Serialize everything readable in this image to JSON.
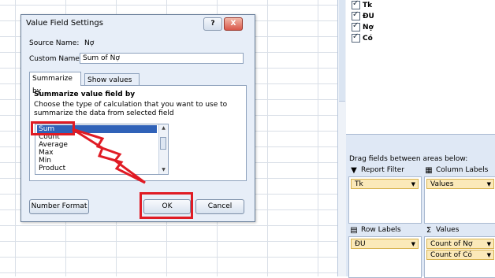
{
  "dialog": {
    "title": "Value Field Settings",
    "help_label": "?",
    "close_label": "X",
    "source_name_label": "Source Name:",
    "source_name_value": "Nợ",
    "custom_name_label": "Custom Name:",
    "custom_name_value": "Sum of Nợ",
    "tabs": [
      {
        "label": "Summarize by"
      },
      {
        "label": "Show values as"
      }
    ],
    "section_title": "Summarize value field by",
    "description": "Choose the type of calculation that you want to use to summarize the data from selected field",
    "functions": [
      "Sum",
      "Count",
      "Average",
      "Max",
      "Min",
      "Product"
    ],
    "selected_function": "Sum",
    "number_format_label": "Number Format",
    "ok_label": "OK",
    "cancel_label": "Cancel"
  },
  "field_list": {
    "fields": [
      {
        "label": "Tk"
      },
      {
        "label": "ĐU"
      },
      {
        "label": "Nợ"
      },
      {
        "label": "Có"
      }
    ],
    "drag_hint": "Drag fields between areas below:",
    "report_filter": {
      "label": "Report Filter",
      "items": [
        "Tk"
      ]
    },
    "column_labels": {
      "label": "Column Labels",
      "items": [
        "Values"
      ]
    },
    "row_labels": {
      "label": "Row Labels",
      "items": [
        "ĐU"
      ]
    },
    "values": {
      "label": "Values",
      "items": [
        "Count of Nợ",
        "Count of Có"
      ]
    },
    "icons": {
      "filter": "filter-icon",
      "columns": "column-labels-icon",
      "rows": "row-labels-icon",
      "values": "sigma-icon"
    }
  },
  "colors": {
    "highlight": "#e01b24",
    "selection": "#3062b8",
    "pill": "#fbe9b9"
  }
}
